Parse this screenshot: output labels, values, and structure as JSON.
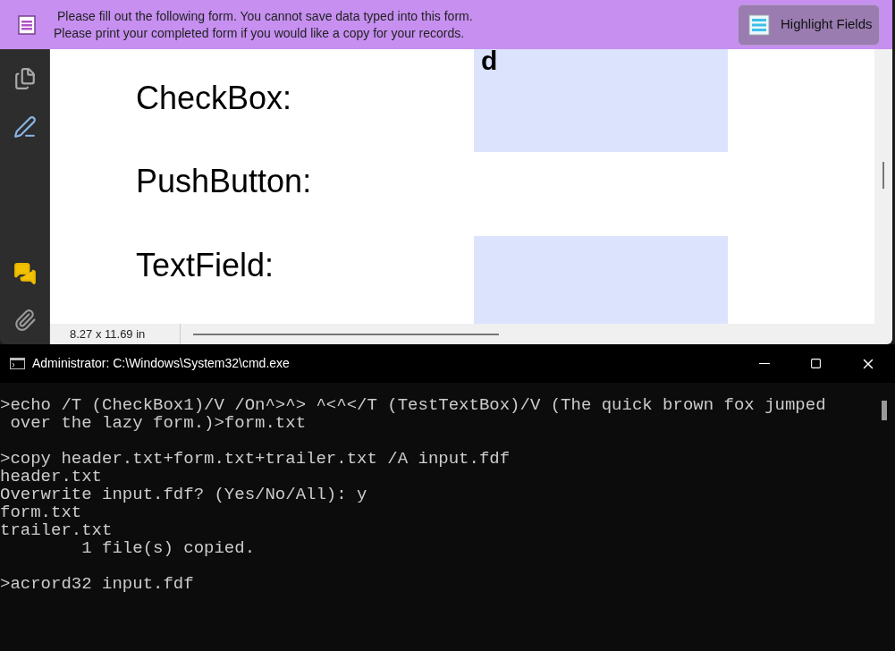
{
  "form_bar": {
    "message": [
      "Please fill out the following form. You cannot save data typed into this form.",
      "Please print your completed form if you would like a copy for your records."
    ],
    "button": "Highlight Fields"
  },
  "form_rows": [
    {
      "label": "CheckBox:",
      "highlighted": true,
      "value": "d"
    },
    {
      "label": "PushButton:",
      "highlighted": false
    },
    {
      "label": "TextField:",
      "highlighted": true
    }
  ],
  "status_bar": {
    "page_size": "8.27 x 11.69 in"
  },
  "console": {
    "title": "Administrator: C:\\Windows\\System32\\cmd.exe",
    "blocks": [
      [
        ">echo /T (CheckBox1)/V /On^>^> ^<^</T (TestTextBox)/V (The quick brown fox jumped",
        " over the lazy form.)>form.txt"
      ],
      [
        ">copy header.txt+form.txt+trailer.txt /A input.fdf",
        "header.txt",
        "Overwrite input.fdf? (Yes/No/All): y",
        "form.txt",
        "trailer.txt",
        "        1 file(s) copied."
      ],
      [
        ">acrord32 input.fdf"
      ]
    ]
  }
}
